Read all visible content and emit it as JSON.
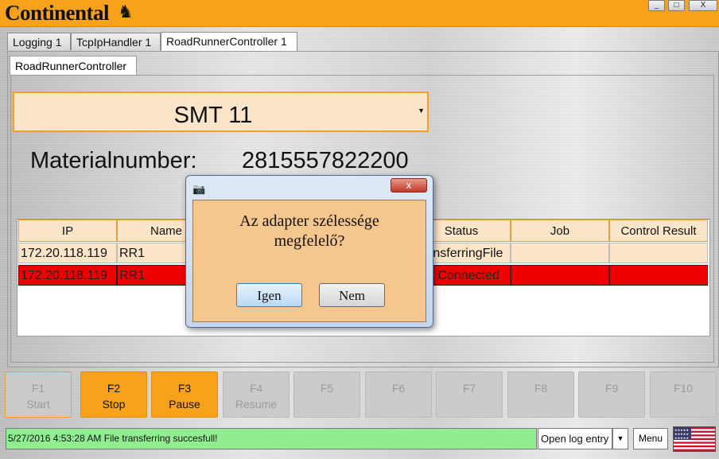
{
  "window": {
    "brand": "Continental",
    "minimize_label": "_",
    "maximize_label": "□",
    "close_label": "X"
  },
  "tabs": [
    {
      "label": "Logging 1"
    },
    {
      "label": "TcpIpHandler 1"
    },
    {
      "label": "RoadRunnerController 1"
    }
  ],
  "subtab": {
    "label": "RoadRunnerController"
  },
  "machine_select": {
    "selected": "SMT 11"
  },
  "material": {
    "label": "Materialnumber:",
    "value": "2815557822200"
  },
  "table": {
    "headers": [
      "IP",
      "Name",
      "Status",
      "Job",
      "Control Result"
    ],
    "rows": [
      {
        "ip": "172.20.118.119",
        "name": "RR1",
        "status": "TransferringFile",
        "job": "",
        "result": "",
        "color": "#fbe5c8"
      },
      {
        "ip": "172.20.118.119",
        "name": "RR1",
        "status": "Not Connected",
        "job": "",
        "result": "",
        "color": "#ee0000"
      }
    ]
  },
  "dialog": {
    "message_line1": "Az adapter szélessége",
    "message_line2": "megfelelő?",
    "yes_label": "Igen",
    "no_label": "Nem",
    "close_label": "x"
  },
  "function_keys": [
    {
      "key": "F1",
      "label": "Start",
      "enabled": false
    },
    {
      "key": "F2",
      "label": "Stop",
      "enabled": true
    },
    {
      "key": "F3",
      "label": "Pause",
      "enabled": true
    },
    {
      "key": "F4",
      "label": "Resume",
      "enabled": false
    },
    {
      "key": "F5",
      "label": "",
      "enabled": false
    },
    {
      "key": "F6",
      "label": "",
      "enabled": false
    },
    {
      "key": "F7",
      "label": "",
      "enabled": false
    },
    {
      "key": "F8",
      "label": "",
      "enabled": false
    },
    {
      "key": "F9",
      "label": "",
      "enabled": false
    },
    {
      "key": "F10",
      "label": "",
      "enabled": false
    }
  ],
  "status": {
    "text": "5/27/2016 4:53:28 AM   File transferring succesfull!",
    "color": "#90ee90",
    "log_button": "Open log entry",
    "menu_button": "Menu",
    "language_flag": "us-flag-icon"
  },
  "colors": {
    "accent": "#f7a21a",
    "alert_row": "#ee0000"
  }
}
